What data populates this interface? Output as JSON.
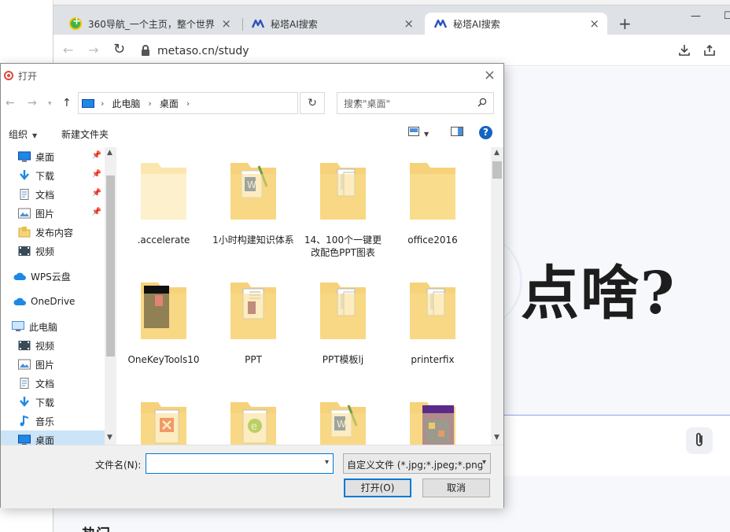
{
  "browser": {
    "tabs": [
      {
        "label": "360导航_一个主页，整个世界",
        "close": "×"
      },
      {
        "label": "秘塔AI搜索",
        "close": "×"
      },
      {
        "label": "秘塔AI搜索",
        "close": "×"
      }
    ],
    "new_tab": "+",
    "url": "metaso.cn/study",
    "nav": {
      "back": "←",
      "forward": "→",
      "reload": "↻"
    }
  },
  "page": {
    "hero": "点啥?",
    "hot_label": "热门"
  },
  "dialog": {
    "title": "打开",
    "close": "×",
    "breadcrumb": [
      "此电脑",
      "桌面"
    ],
    "search_placeholder": "搜索\"桌面\"",
    "commands": {
      "organize": "组织",
      "new_folder": "新建文件夹"
    },
    "help": "?",
    "nav_items": [
      {
        "label": "桌面",
        "icon": "desktop-icon",
        "pinned": true
      },
      {
        "label": "下载",
        "icon": "download-icon",
        "pinned": true
      },
      {
        "label": "文档",
        "icon": "document-icon",
        "pinned": true
      },
      {
        "label": "图片",
        "icon": "picture-icon",
        "pinned": true
      },
      {
        "label": "发布内容",
        "icon": "folder-icon",
        "pinned": false
      },
      {
        "label": "视频",
        "icon": "video-icon",
        "pinned": false
      },
      {
        "label": "WPS云盘",
        "icon": "cloud-icon",
        "pinned": false
      },
      {
        "label": "OneDrive",
        "icon": "cloud-icon",
        "pinned": false
      },
      {
        "label": "此电脑",
        "icon": "computer-icon",
        "pinned": false
      },
      {
        "label": "视频",
        "icon": "video-icon",
        "pinned": false
      },
      {
        "label": "图片",
        "icon": "picture-icon",
        "pinned": false
      },
      {
        "label": "文档",
        "icon": "document-icon",
        "pinned": false
      },
      {
        "label": "下载",
        "icon": "download-icon",
        "pinned": false
      },
      {
        "label": "音乐",
        "icon": "music-icon",
        "pinned": false
      },
      {
        "label": "桌面",
        "icon": "desktop-icon",
        "pinned": false
      }
    ],
    "files": [
      {
        "name": ".accelerate",
        "kind": "folder-faded"
      },
      {
        "name": "1小时构建知识体系",
        "kind": "folder-word"
      },
      {
        "name": "14、100个一键更改配色PPT图表",
        "kind": "folder-docs"
      },
      {
        "name": "office2016",
        "kind": "folder-plain"
      },
      {
        "name": "OneKeyTools10",
        "kind": "folder-dark"
      },
      {
        "name": "PPT",
        "kind": "folder-ppt"
      },
      {
        "name": "PPT模板lj",
        "kind": "folder-docs"
      },
      {
        "name": "printerfix",
        "kind": "folder-docs"
      },
      {
        "name": "",
        "kind": "folder-xmind"
      },
      {
        "name": "",
        "kind": "folder-green"
      },
      {
        "name": "",
        "kind": "folder-word"
      },
      {
        "name": "",
        "kind": "folder-book"
      }
    ],
    "filename_label": "文件名(N):",
    "filename_value": "",
    "filter_value": "自定义文件 (*.jpg;*.jpeg;*.png",
    "open_button": "打开(O)",
    "cancel_button": "取消"
  },
  "colors": {
    "accent": "#0078d7",
    "folder": "#f6d27a",
    "selection": "#cce4f7"
  }
}
